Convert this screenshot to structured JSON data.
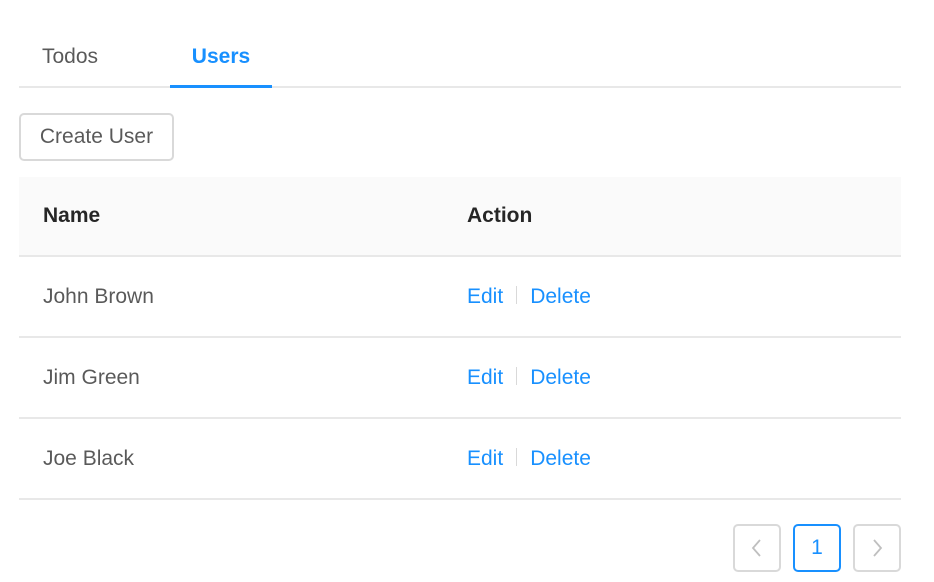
{
  "tabs": [
    {
      "label": "Todos",
      "active": false
    },
    {
      "label": "Users",
      "active": true
    }
  ],
  "toolbar": {
    "create_label": "Create User"
  },
  "table": {
    "columns": [
      "Name",
      "Action"
    ],
    "rows": [
      {
        "name": "John Brown",
        "edit": "Edit",
        "delete": "Delete"
      },
      {
        "name": "Jim Green",
        "edit": "Edit",
        "delete": "Delete"
      },
      {
        "name": "Joe Black",
        "edit": "Edit",
        "delete": "Delete"
      }
    ]
  },
  "pagination": {
    "current_page": "1",
    "prev_icon": "chevron-left-icon",
    "next_icon": "chevron-right-icon"
  },
  "colors": {
    "accent": "#1890ff",
    "border": "#e8e8e8",
    "header_bg": "#fafafa"
  }
}
